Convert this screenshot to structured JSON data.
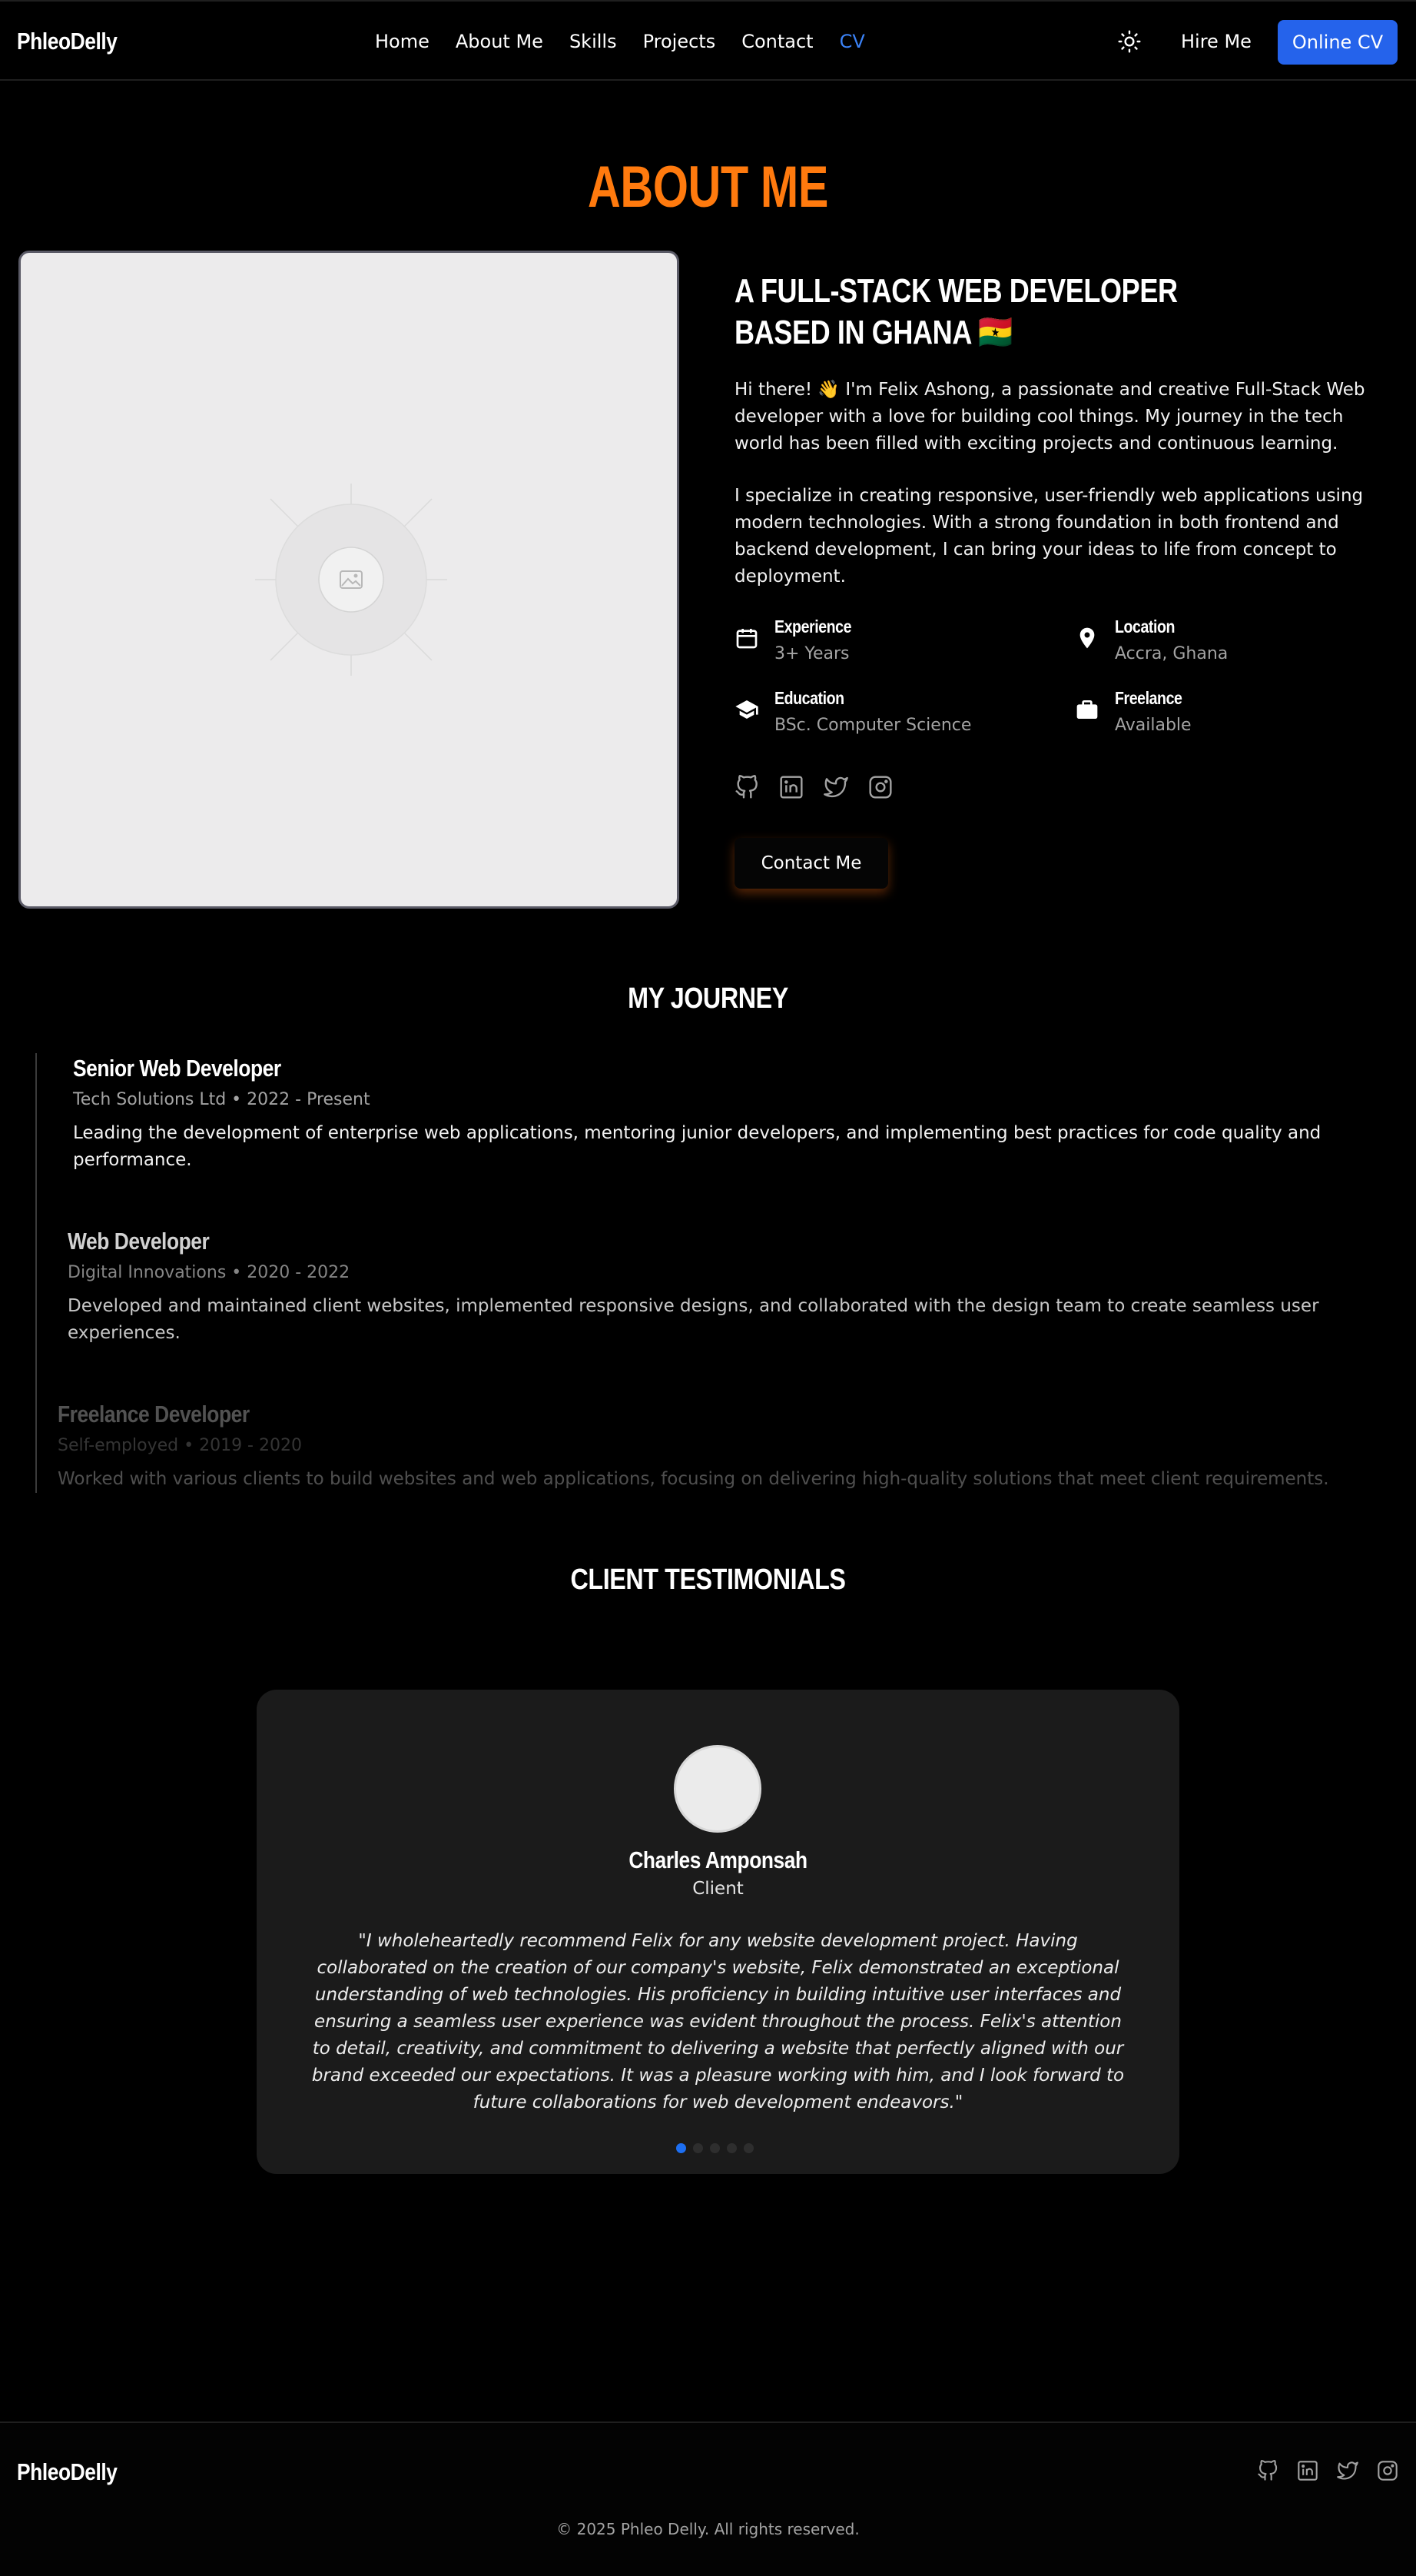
{
  "nav": {
    "brand": "PhleoDelly",
    "links": [
      "Home",
      "About Me",
      "Skills",
      "Projects",
      "Contact",
      "CV"
    ],
    "theme_toggle_icon": "sun-icon",
    "hire_label": "Hire Me",
    "online_cv_label": "Online CV"
  },
  "about": {
    "title": "ABOUT ME",
    "headline_line1": "A FULL-STACK WEB DEVELOPER",
    "headline_line2": "BASED IN GHANA 🇬🇭",
    "paragraph1": "Hi there! 👋 I'm Felix Ashong, a passionate and creative Full-Stack Web developer with a love for building cool things. My journey in the tech world has been filled with exciting projects and continuous learning.",
    "paragraph2": "I specialize in creating responsive, user-friendly web applications using modern technologies. With a strong foundation in both frontend and backend development, I can bring your ideas to life from concept to deployment.",
    "info": [
      {
        "label": "Experience",
        "value": "3+ Years",
        "icon": "calendar-icon"
      },
      {
        "label": "Location",
        "value": "Accra, Ghana",
        "icon": "map-pin-icon"
      },
      {
        "label": "Education",
        "value": "BSc. Computer Science",
        "icon": "graduation-cap-icon"
      },
      {
        "label": "Freelance",
        "value": "Available",
        "icon": "briefcase-icon"
      }
    ],
    "socials": [
      "github-icon",
      "linkedin-icon",
      "twitter-icon",
      "instagram-icon"
    ],
    "contact_label": "Contact Me"
  },
  "journey": {
    "title": "MY JOURNEY",
    "items": [
      {
        "role": "Senior Web Developer",
        "meta": "Tech Solutions Ltd • 2022 - Present",
        "desc": "Leading the development of enterprise web applications, mentoring junior developers, and implementing best practices for code quality and performance."
      },
      {
        "role": "Web Developer",
        "meta": "Digital Innovations • 2020 - 2022",
        "desc": "Developed and maintained client websites, implemented responsive designs, and collaborated with the design team to create seamless user experiences."
      },
      {
        "role": "Freelance Developer",
        "meta": "Self-employed • 2019 - 2020",
        "desc": "Worked with various clients to build websites and web applications, focusing on delivering high-quality solutions that meet client requirements."
      }
    ]
  },
  "testimonials": {
    "title": "CLIENT TESTIMONIALS",
    "name": "Charles Amponsah",
    "role": "Client",
    "quote": "\"I wholeheartedly recommend Felix for any website development project. Having collaborated on the creation of our company's website, Felix demonstrated an exceptional understanding of web technologies. His proficiency in building intuitive user interfaces and ensuring a seamless user experience was evident throughout the process. Felix's attention to detail, creativity, and commitment to delivering a website that perfectly aligned with our brand exceeded our expectations. It was a pleasure working with him, and I look forward to future collaborations for web development endeavors.\"",
    "dot_count": 5,
    "active_dot": 0
  },
  "footer": {
    "brand": "PhleoDelly",
    "socials": [
      "github-icon",
      "linkedin-icon",
      "twitter-icon",
      "instagram-icon"
    ],
    "copyright": "© 2025 Phleo Delly. All rights reserved."
  },
  "colors": {
    "accent_orange": "#ff7a0e",
    "primary_blue": "#2563eb",
    "background": "#000000",
    "card": "#1b1b1b"
  }
}
